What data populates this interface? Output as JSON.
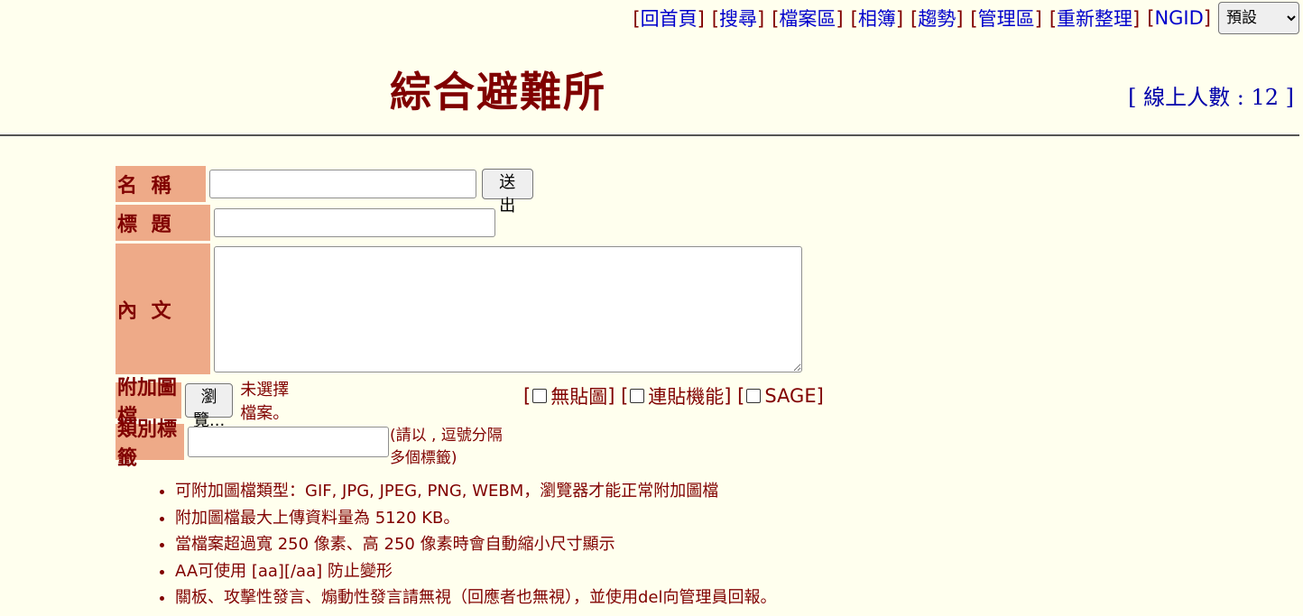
{
  "nav": {
    "items": [
      "回首頁",
      "搜尋",
      "檔案區",
      "相簿",
      "趨勢",
      "管理區",
      "重新整理",
      "NGID"
    ],
    "theme_select": "預設"
  },
  "header": {
    "title": "綜合避難所",
    "online": "[ 線上人數 : 12 ]"
  },
  "form": {
    "name_label": "名 稱",
    "subject_label": "標 題",
    "content_label": "內 文",
    "attach_label": "附加圖檔",
    "tags_label": "類別標籤",
    "submit_label": "送 出",
    "browse_label": "瀏覽...",
    "no_file_text": "未選擇檔案。",
    "opt_noimg": "無貼圖",
    "opt_continuous": "連貼機能",
    "opt_sage": "SAGE",
    "tags_hint": "(請以 , 逗號分隔多個標籤)"
  },
  "notes": [
    "可附加圖檔類型：GIF, JPG, JPEG, PNG, WEBM，瀏覽器才能正常附加圖檔",
    "附加圖檔最大上傳資料量為 5120 KB。",
    "當檔案超過寬 250 像素、高 250 像素時會自動縮小尺寸顯示",
    "AA可使用 [aa][/aa] 防止變形",
    "關板、攻擊性發言、煽動性發言請無視（回應者也無視），並使用del向管理員回報。"
  ],
  "colors": {
    "background": "#ffffee",
    "label_bg": "#eeaa88",
    "text": "#800000",
    "link": "#0000cc"
  }
}
